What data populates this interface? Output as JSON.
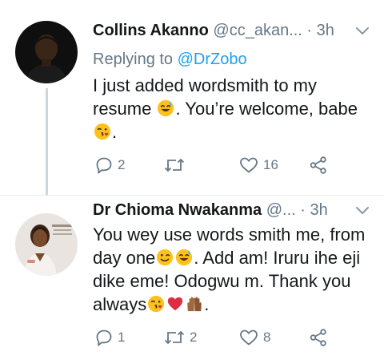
{
  "tweets": [
    {
      "name": "Collins Akanno",
      "handle": "@cc_akan...",
      "separator": "·",
      "time": "3h",
      "replying_prefix": "Replying to ",
      "replying_to": "@DrZobo",
      "text_parts": [
        "I just added wordsmith to my resume ",
        ". You’re welcome, babe ",
        "."
      ],
      "emojis": [
        "sweat-smile-emoji",
        "kissing-heart-emoji"
      ],
      "actions": {
        "reply_count": "2",
        "retweet_count": "",
        "like_count": "16"
      }
    },
    {
      "name": "Dr Chioma Nwakanma",
      "handle": "@...",
      "separator": "·",
      "time": "3h",
      "text_parts": [
        "You wey use words smith me, from day one",
        ". Add am! Iruru ihe eji dike eme! Odogwu m. Thank you always",
        "."
      ],
      "emojis": [
        "winking-face-emoji",
        "sweat-smile-emoji",
        "kissing-heart-emoji",
        "red-heart-emoji",
        "raising-hands-emoji"
      ],
      "actions": {
        "reply_count": "1",
        "retweet_count": "2",
        "like_count": "8"
      }
    }
  ],
  "colors": {
    "name": "#14171a",
    "secondary": "#657786",
    "link": "#1da1f2",
    "divider": "#e6ecf0",
    "thread_line": "#ccd6dd"
  },
  "icons": [
    "reply-icon",
    "retweet-icon",
    "like-icon",
    "share-icon",
    "chevron-down-icon"
  ]
}
